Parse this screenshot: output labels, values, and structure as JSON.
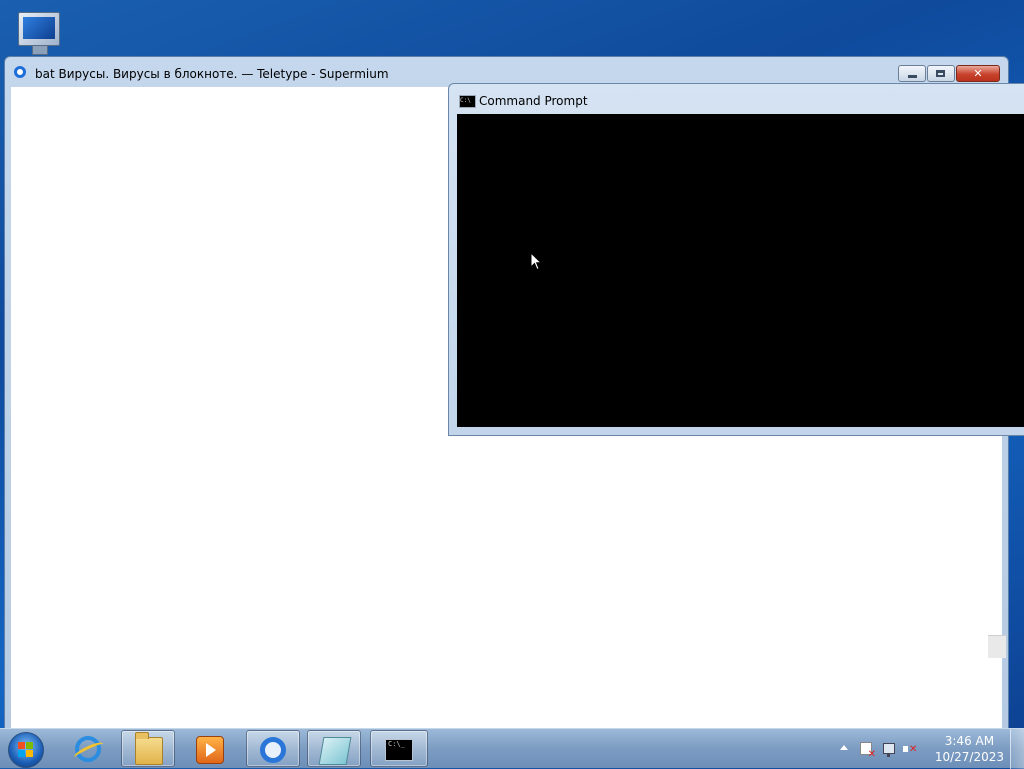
{
  "desktop": {
    "icons": [
      {
        "name": "computer-icon"
      }
    ]
  },
  "browser": {
    "title": "bat Вирусы. Вирусы в блокноте. — Teletype - Supermium",
    "close_glyph": "✕"
  },
  "cmd": {
    "title": "Command Prompt",
    "icon_text": "C:\\"
  },
  "taskbar": {
    "items": [
      {
        "name": "internet-explorer",
        "active": false
      },
      {
        "name": "file-explorer",
        "active": true
      },
      {
        "name": "media-player",
        "active": false
      },
      {
        "name": "supermium-browser",
        "active": true
      },
      {
        "name": "notepad",
        "active": true
      },
      {
        "name": "command-prompt",
        "active": true
      }
    ],
    "cmd_icon_text": "C:\\_"
  },
  "tray": {
    "time": "3:46 AM",
    "date": "10/27/2023"
  },
  "colors": {
    "desktop": "#1466c4",
    "console_bg": "#000000",
    "close_button": "#c8432c"
  }
}
